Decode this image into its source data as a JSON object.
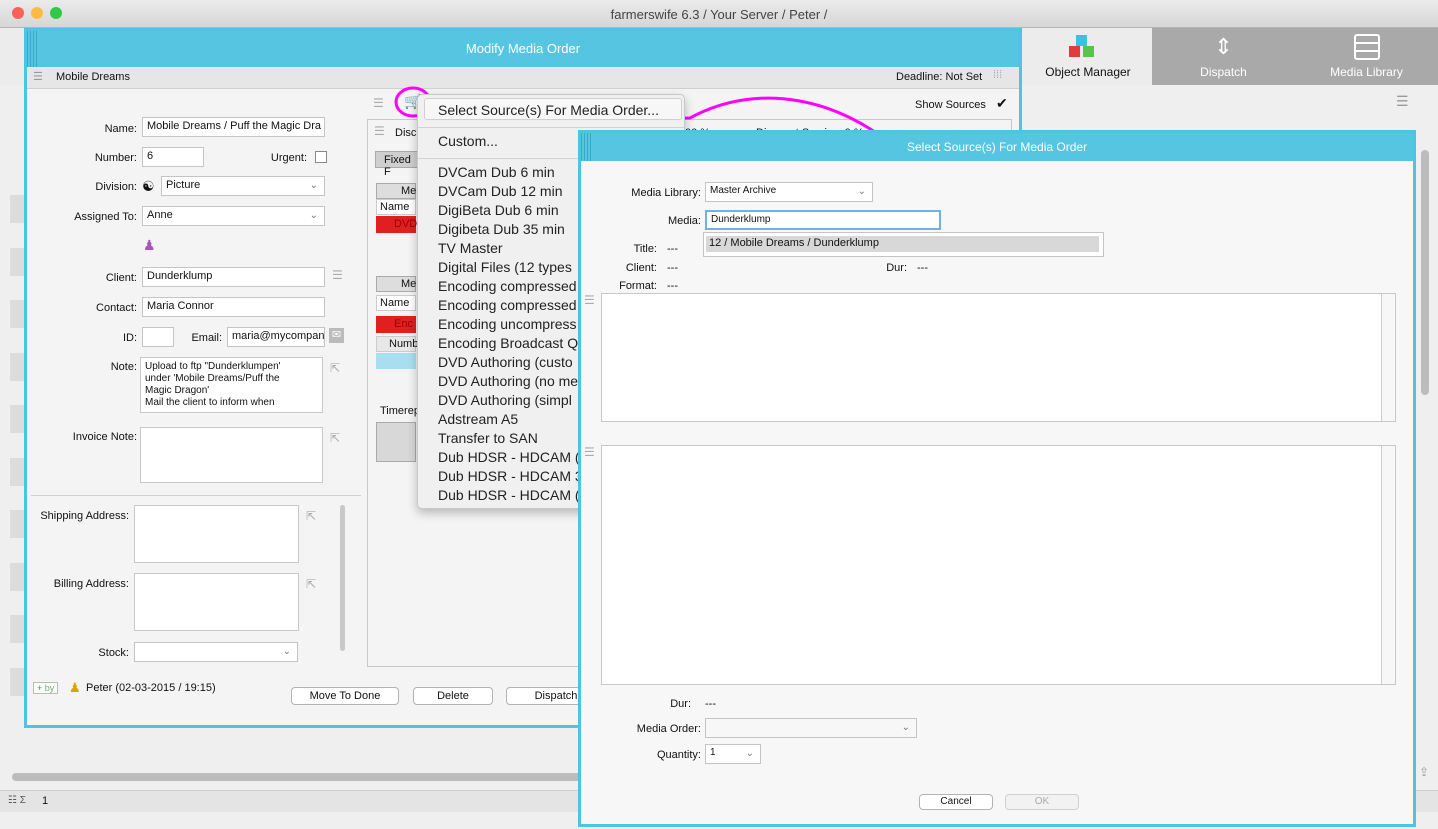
{
  "app": {
    "title": "farmerswife 6.3  / Your Server / Peter /"
  },
  "top_tabs": [
    {
      "label": "Object Manager",
      "icon": "cubes-icon"
    },
    {
      "label": "Dispatch",
      "icon": "dispatch-arrows-icon"
    },
    {
      "label": "Media Library",
      "icon": "cabinet-icon"
    }
  ],
  "status_bar": {
    "count": "1"
  },
  "modify_window": {
    "title": "Modify Media Order",
    "header_name": "Mobile Dreams",
    "deadline": "Deadline: Not Set",
    "show_sources_label": "Show Sources",
    "fields": {
      "name_label": "Name:",
      "name_value": "Mobile Dreams / Puff the Magic Dra",
      "number_label": "Number:",
      "number_value": "6",
      "urgent_label": "Urgent:",
      "division_label": "Division:",
      "division_value": "Picture",
      "assigned_label": "Assigned To:",
      "assigned_value": "Anne",
      "client_label": "Client:",
      "client_value": "Dunderklump",
      "contact_label": "Contact:",
      "contact_value": "Maria Connor",
      "id_label": "ID:",
      "email_label": "Email:",
      "email_value": "maria@mycompan",
      "note_label": "Note:",
      "note_lines": [
        "Upload to ftp \"Dunderklumpen'",
        "under 'Mobile Dreams/Puff the",
        "Magic Dragon'",
        "Mail the client to inform when"
      ],
      "invoice_label": "Invoice Note:",
      "shipping_label": "Shipping Address:",
      "billing_label": "Billing Address:",
      "stock_label": "Stock:"
    },
    "footer_user": "Peter (02-03-2015 / 19:15)",
    "by_badge": "by",
    "buttons": {
      "move_done": "Move To Done",
      "delete": "Delete",
      "dispatch": "Dispatch"
    },
    "right_panel": {
      "disc_label": "Disc",
      "fixed_label": "Fixed F",
      "me1": "Me",
      "name1": "Name",
      "dvd_label": "DVD",
      "me2": "Me",
      "name2": "Name",
      "enc_label": "Enc",
      "numb_label": "Numb",
      "timerep_label": "Timerep",
      "pct_label": "00 %",
      "discount_label": "Discount Service: 0 %"
    }
  },
  "dropdown_menu": {
    "items": [
      "Select Source(s) For Media Order...",
      "Custom...",
      "DVCam Dub 6 min",
      "DVCam Dub 12 min",
      "DigiBeta Dub 6 min",
      "Digibeta Dub 35 min",
      "TV Master",
      "Digital Files (12 types",
      "Encoding compressed",
      "Encoding compressed",
      "Encoding uncompress",
      "Encoding Broadcast Q",
      "DVD Authoring (custo",
      "DVD Authoring (no me",
      "DVD Authoring (simpl",
      "Adstream A5",
      "Transfer to SAN",
      "Dub HDSR - HDCAM (",
      "Dub HDSR - HDCAM 3",
      "Dub HDSR - HDCAM ("
    ]
  },
  "select_window": {
    "title": "Select Source(s) For Media Order",
    "media_library_label": "Media Library:",
    "media_library_value": "Master Archive",
    "media_label": "Media:",
    "media_value": "Dunderklump",
    "suggestion": "12 / Mobile Dreams / Dunderklump",
    "title_label": "Title:",
    "title_value": "---",
    "client_label": "Client:",
    "client_value": "---",
    "dur_label": "Dur:",
    "dur_value": "---",
    "format_label": "Format:",
    "format_value": "---",
    "dur2_label": "Dur:",
    "dur2_value": "---",
    "media_order_label": "Media Order:",
    "quantity_label": "Quantity:",
    "quantity_value": "1",
    "cancel_label": "Cancel",
    "ok_label": "OK"
  },
  "colors": {
    "accent": "#55c5e2",
    "highlight": "#ff00ff",
    "alert": "#e02020"
  }
}
